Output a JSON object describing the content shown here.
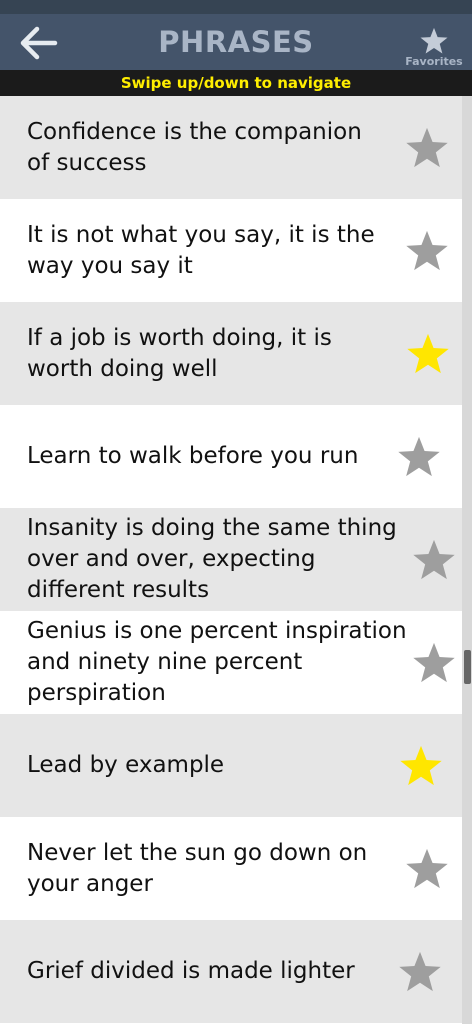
{
  "app": {
    "title": "PHRASES",
    "favorites_label": "Favorites",
    "hint": "Swipe up/down to navigate"
  },
  "icons": {
    "back": "arrow-left-icon",
    "favorites": "star-icon"
  },
  "colors": {
    "appbar": "#44546a",
    "statusbar": "#364453",
    "header_text": "#a9b5c6",
    "hint_bg": "#1b1b1b",
    "hint_text": "#ffee00",
    "row_shaded": "#e6e6e6",
    "row_plain": "#ffffff",
    "star_off": "#9e9e9e",
    "star_on": "#ffe600"
  },
  "phrases": [
    {
      "lines": [
        "Confidence is the companion",
        "of success"
      ],
      "favorite": false
    },
    {
      "lines": [
        "It is not what you say, it is the",
        "way you say it"
      ],
      "favorite": false
    },
    {
      "lines": [
        "If a job is worth doing, it is",
        "worth doing well"
      ],
      "favorite": true
    },
    {
      "lines": [
        "Learn to walk before you run"
      ],
      "favorite": false
    },
    {
      "lines": [
        "Insanity is doing the same thing",
        "over and over, expecting",
        "different results"
      ],
      "favorite": false
    },
    {
      "lines": [
        "Genius is one percent inspiration",
        "and ninety nine percent",
        "perspiration"
      ],
      "favorite": false
    },
    {
      "lines": [
        "Lead by example"
      ],
      "favorite": true
    },
    {
      "lines": [
        "Never let the sun go down on",
        "your anger"
      ],
      "favorite": false
    },
    {
      "lines": [
        "Grief divided is made lighter"
      ],
      "favorite": false
    }
  ]
}
